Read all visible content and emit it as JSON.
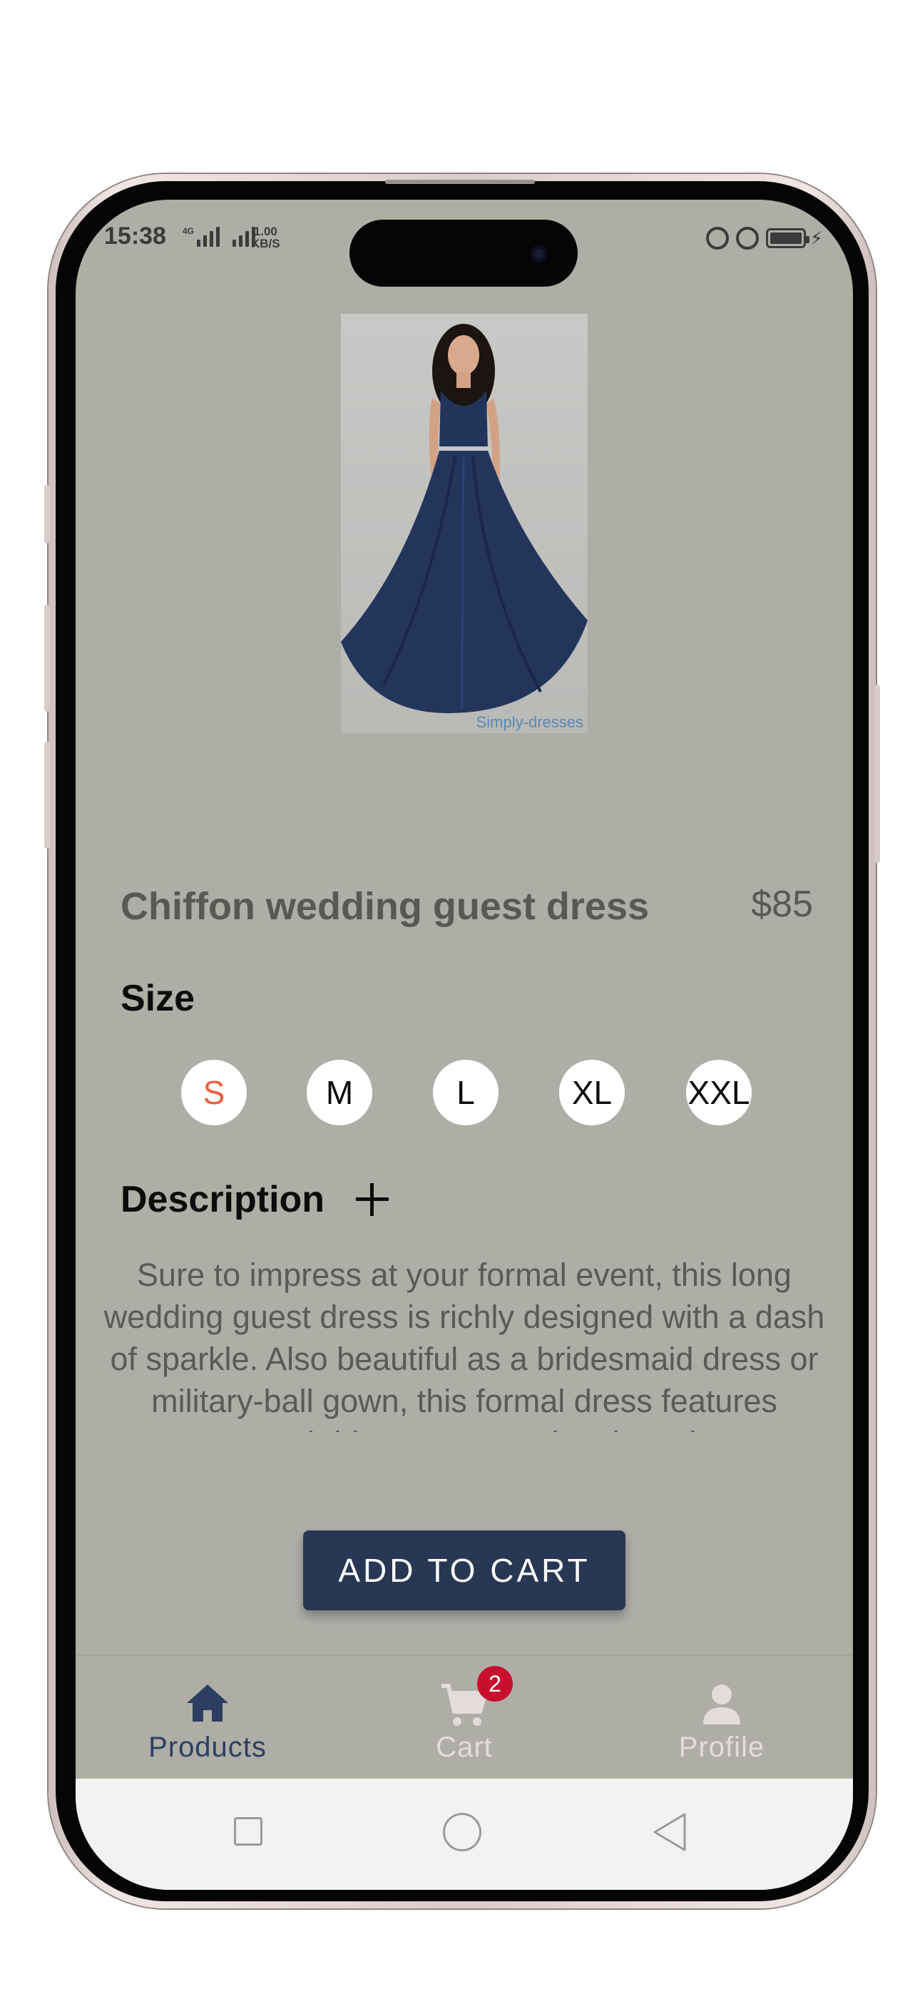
{
  "status_bar": {
    "time": "15:38",
    "network_tag": "4G",
    "speed_value": "1.00",
    "speed_unit": "KB/S"
  },
  "product": {
    "image_watermark": "Simply-dresses",
    "title": "Chiffon wedding guest dress",
    "price": "$85",
    "size_heading": "Size",
    "sizes": [
      "S",
      "M",
      "L",
      "XL",
      "XXL"
    ],
    "selected_size": "S",
    "description_heading": "Description",
    "description": "Sure to impress at your formal event, this long wedding guest dress is richly designed with a dash of sparkle. Also beautiful as a bridesmaid dress or military-ball gown, this formal dress features scattered rhinestones on the sleeveless embroidered-lace bodice. A sheer-illusion inset",
    "add_to_cart_label": "ADD TO CART"
  },
  "bottom_nav": {
    "items": [
      {
        "label": "Products",
        "icon": "home-icon",
        "active": true
      },
      {
        "label": "Cart",
        "icon": "cart-icon",
        "active": false,
        "badge": "2"
      },
      {
        "label": "Profile",
        "icon": "person-icon",
        "active": false
      }
    ]
  },
  "colors": {
    "screen_bg": "#aeada6",
    "primary": "#283753",
    "active_nav": "#2d3e62",
    "selected_size": "#ef5e40",
    "badge": "#c8102e"
  }
}
